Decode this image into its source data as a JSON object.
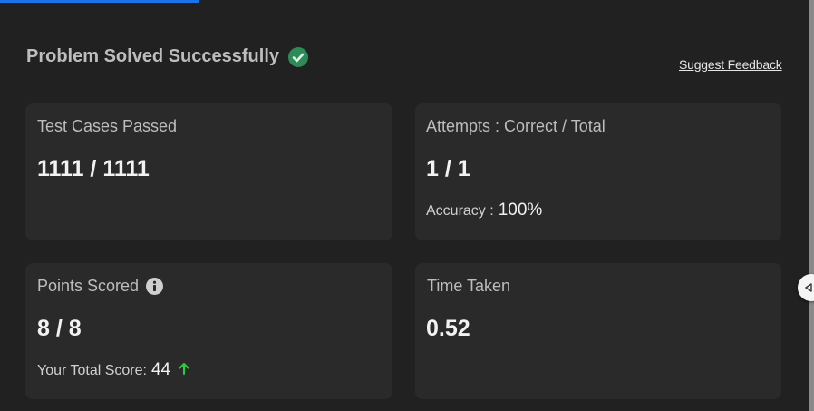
{
  "header": {
    "title": "Problem Solved Successfully",
    "feedback_link": "Suggest Feedback"
  },
  "cards": {
    "test_cases": {
      "label": "Test Cases Passed",
      "value": "1111 / 1111"
    },
    "attempts": {
      "label": "Attempts : Correct / Total",
      "value": "1 / 1",
      "extra_label": "Accuracy :",
      "extra_value": "100%"
    },
    "points": {
      "label": "Points Scored",
      "value": "8 / 8",
      "extra_label": "Your Total Score:",
      "extra_value": "44"
    },
    "time": {
      "label": "Time Taken",
      "value": "0.52"
    }
  },
  "icons": {
    "success": "check-circle-icon",
    "points_info": "info-icon",
    "score_trend": "arrow-up-icon",
    "panel_toggle": "triangle-left-icon"
  },
  "colors": {
    "success": "#2e8b57",
    "trend_up": "#2ecc40",
    "accent": "#1a73e8"
  }
}
